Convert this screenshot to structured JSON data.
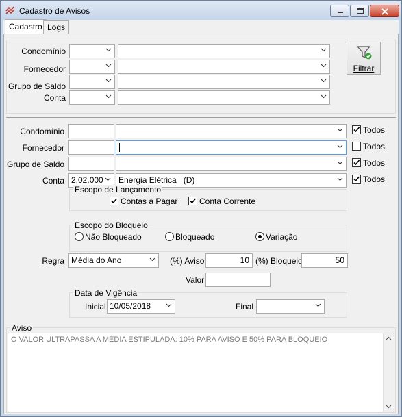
{
  "window": {
    "title": "Cadastro de Avisos"
  },
  "tabs": [
    "Cadastro",
    "Logs"
  ],
  "filter": {
    "labels": [
      "Condomínio",
      "Fornecedor",
      "Grupo de Saldo",
      "Conta"
    ],
    "button_label": "Filtrar"
  },
  "form": {
    "labels": [
      "Condomínio",
      "Fornecedor",
      "Grupo de Saldo",
      "Conta"
    ],
    "conta_code": "2.02.000",
    "conta_desc": "Energia Elétrica   (D)",
    "todos_label": "Todos",
    "todos_checked": [
      true,
      false,
      true,
      true
    ]
  },
  "escopo_lancamento": {
    "title": "Escopo de Lançamento",
    "contas_pagar": "Contas a Pagar",
    "conta_corrente": "Conta Corrente",
    "contas_pagar_checked": true,
    "conta_corrente_checked": true
  },
  "escopo_bloqueio": {
    "title": "Escopo do Bloqueio",
    "options": [
      "Não Bloqueado",
      "Bloqueado",
      "Variação"
    ],
    "selected": "Variação"
  },
  "regra": {
    "label": "Regra",
    "value": "Média do Ano",
    "aviso_label": "(%) Aviso",
    "aviso_value": "10",
    "bloqueio_label": "(%) Bloqueio",
    "bloqueio_value": "50",
    "valor_label": "Valor",
    "valor_value": ""
  },
  "vigencia": {
    "title": "Data de Vigência",
    "inicial_label": "Inicial",
    "inicial_value": "10/05/2018",
    "final_label": "Final",
    "final_value": ""
  },
  "aviso": {
    "label": "Aviso",
    "text": "O VALOR ULTRAPASSA A MÉDIA ESTIPULADA: 10% PARA AVISO E 50% PARA BLOQUEIO"
  }
}
